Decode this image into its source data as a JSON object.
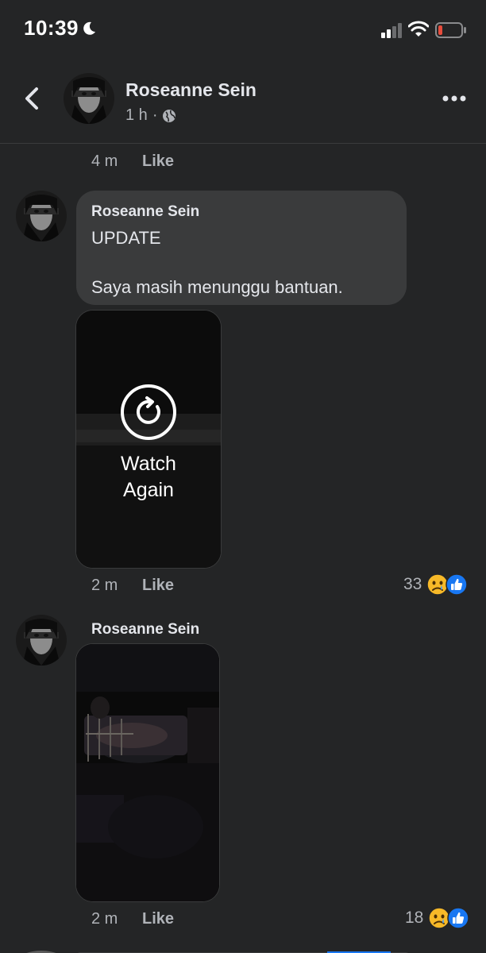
{
  "status_bar": {
    "time": "10:39"
  },
  "header": {
    "name": "Roseanne Sein",
    "time_ago": "1 h",
    "separator": "·"
  },
  "top_action": {
    "time": "4 m",
    "like": "Like"
  },
  "comment1": {
    "author": "Roseanne Sein",
    "text": "UPDATE\n\nSaya masih menunggu bantuan.",
    "video_overlay_label": "Watch\nAgain",
    "time": "2 m",
    "like": "Like",
    "reaction_count": "33"
  },
  "comment2": {
    "author": "Roseanne Sein",
    "time": "2 m",
    "like": "Like",
    "reaction_count": "18"
  },
  "colors": {
    "background": "#242526",
    "bubble": "#3a3b3c",
    "like_blue": "#1877f2",
    "sad_yellow": "#f7b928",
    "battery_red": "#e74c3c"
  },
  "icons": {
    "back": "chevron-left-icon",
    "more": "more-horizontal-icon",
    "privacy": "globe-icon",
    "replay": "replay-icon",
    "sad_reaction": "sad-face-icon",
    "like_reaction": "thumbs-up-icon"
  }
}
